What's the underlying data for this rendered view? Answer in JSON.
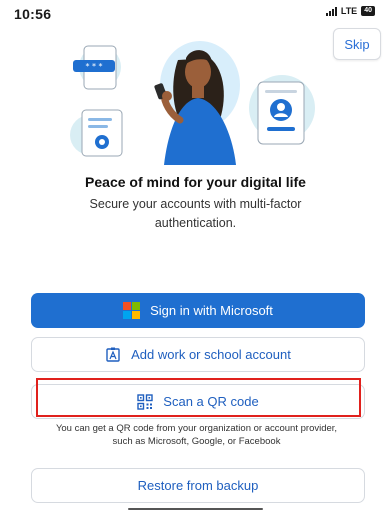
{
  "status_bar": {
    "time": "10:56",
    "network": "LTE",
    "battery": "40"
  },
  "skip_label": "Skip",
  "headline": "Peace of mind for your digital life",
  "subtext": "Secure your accounts with multi-factor authentication.",
  "buttons": {
    "sign_in": "Sign in with Microsoft",
    "work_account": "Add work or school account",
    "scan_qr": "Scan a QR code",
    "restore": "Restore from backup"
  },
  "qr_helper": "You can get a QR code from your organization or account provider, such as Microsoft, Google, or Facebook",
  "colors": {
    "primary": "#1f6fd0",
    "link": "#1f5fbf",
    "highlight": "#e0211d",
    "ms_red": "#f25022",
    "ms_green": "#7fba00",
    "ms_blue": "#00a4ef",
    "ms_yellow": "#ffb900"
  },
  "icons": {
    "signal": "signal-bars-icon",
    "battery": "battery-icon",
    "microsoft": "microsoft-logo-icon",
    "work_account": "id-badge-icon",
    "qr": "qr-code-icon"
  }
}
